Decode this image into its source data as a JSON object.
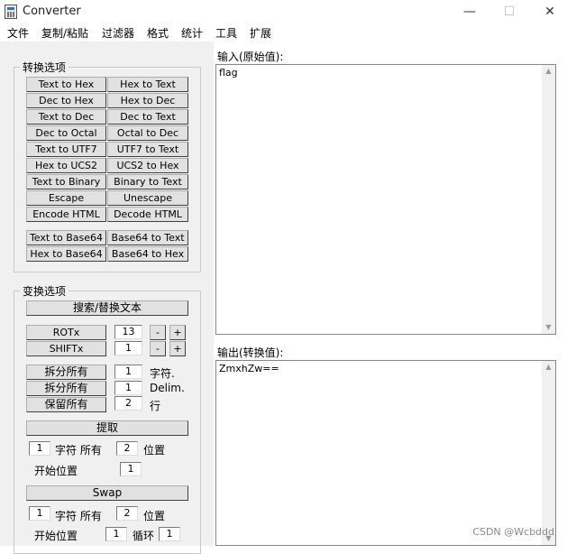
{
  "window": {
    "title": "Converter",
    "minimize": "—",
    "maximize": "☐",
    "close": "✕"
  },
  "menu": [
    "文件",
    "复制/粘贴",
    "过滤器",
    "格式",
    "统计",
    "工具",
    "扩展"
  ],
  "convert": {
    "legend": "转换选项",
    "buttons": [
      "Text to Hex",
      "Hex to Text",
      "Dec to Hex",
      "Hex to Dec",
      "Text to Dec",
      "Dec to Text",
      "Dec to Octal",
      "Octal to Dec",
      "Text to UTF7",
      "UTF7 to Text",
      "Hex to UCS2",
      "UCS2 to Hex",
      "Text to Binary",
      "Binary to Text",
      "Escape",
      "Unescape",
      "Encode HTML",
      "Decode HTML",
      "Text to Base64",
      "Base64 to Text",
      "Hex to Base64",
      "Base64 to Hex"
    ]
  },
  "transform": {
    "legend": "变换选项",
    "search_replace": "搜索/替换文本",
    "rotx": {
      "label": "ROTx",
      "value": "13",
      "minus": "-",
      "plus": "+"
    },
    "shiftx": {
      "label": "SHIFTx",
      "value": "1",
      "minus": "-",
      "plus": "+"
    },
    "split_all_1": {
      "label": "拆分所有",
      "value": "1",
      "suffix": "字符."
    },
    "split_all_2": {
      "label": "拆分所有",
      "value": "1",
      "suffix": "Delim."
    },
    "keep_all": {
      "label": "保留所有",
      "value": "2",
      "suffix": "行"
    },
    "extract": {
      "button": "提取",
      "count_value": "1",
      "count_label": "字符 所有",
      "pos_value": "2",
      "pos_label": "位置",
      "start_label": "开始位置",
      "start_value": "1"
    },
    "swap": {
      "button": "Swap",
      "count_value": "1",
      "count_label": "字符 所有",
      "pos_value": "2",
      "pos_label": "位置",
      "start_label": "开始位置",
      "start_value": "1",
      "loop_label": "循环",
      "loop_value": "1"
    }
  },
  "input": {
    "label": "输入(原始值):",
    "value": "flag"
  },
  "output": {
    "label": "输出(转换值):",
    "value": "ZmxhZw=="
  },
  "watermark": "CSDN @Wcbddd"
}
